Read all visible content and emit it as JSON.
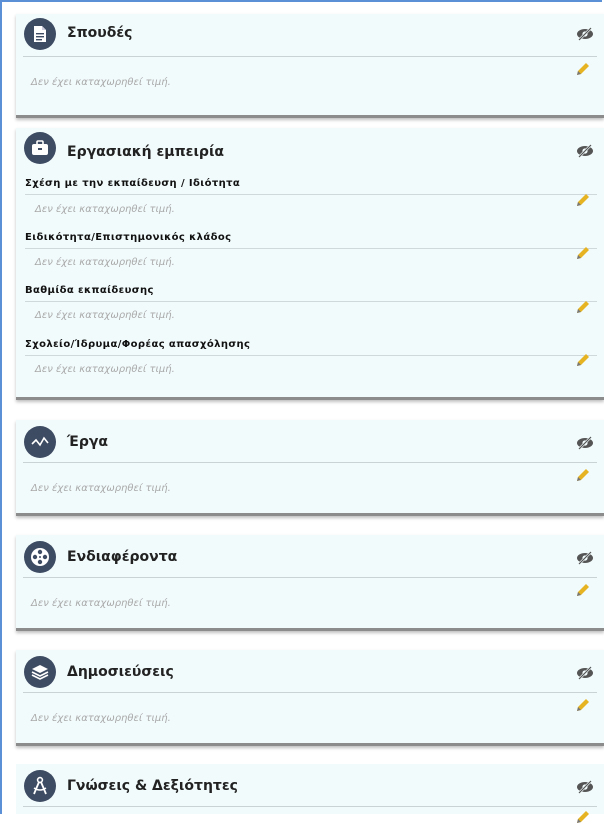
{
  "colors": {
    "card_bg": "#f2fbfc",
    "icon_bg": "#3d4b63",
    "pencil": "#e6b422",
    "frame": "#5b8fd6"
  },
  "empty_text": "Δεν έχει καταχωρηθεί τιμή.",
  "sections": [
    {
      "title": "Σπουδές",
      "icon": "document-icon",
      "visibility_icon": "eye-slash-icon",
      "edit_icon": "pencil-icon"
    },
    {
      "title": "Εργασιακή εμπειρία",
      "icon": "briefcase-icon",
      "visibility_icon": "eye-slash-icon",
      "fields": [
        {
          "label": "Σχέση με την εκπαίδευση / Ιδιότητα"
        },
        {
          "label": "Ειδικότητα/Επιστημονικός κλάδος"
        },
        {
          "label": "Βαθμίδα εκπαίδευσης"
        },
        {
          "label": "Σχολείο/Ίδρυμα/Φορέας απασχόλησης"
        }
      ]
    },
    {
      "title": "Έργα",
      "icon": "activity-icon",
      "visibility_icon": "eye-slash-icon",
      "edit_icon": "pencil-icon"
    },
    {
      "title": "Ενδιαφέροντα",
      "icon": "film-reel-icon",
      "visibility_icon": "eye-slash-icon",
      "edit_icon": "pencil-icon"
    },
    {
      "title": "Δημοσιεύσεις",
      "icon": "layers-icon",
      "visibility_icon": "eye-slash-icon",
      "edit_icon": "pencil-icon"
    },
    {
      "title": "Γνώσεις & Δεξιότητες",
      "icon": "compass-icon",
      "visibility_icon": "eye-slash-icon",
      "edit_icon": "pencil-icon"
    }
  ]
}
